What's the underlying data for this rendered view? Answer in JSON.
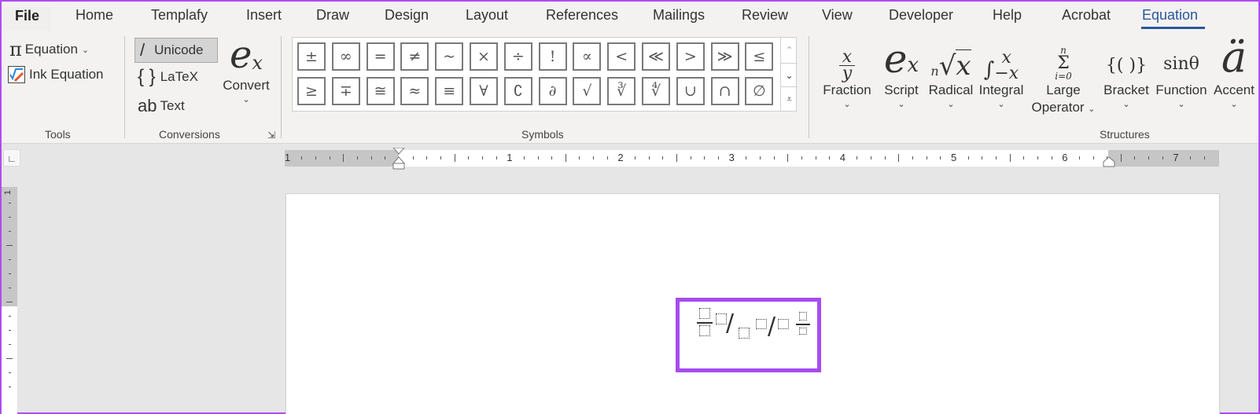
{
  "tabs": [
    {
      "label": "File"
    },
    {
      "label": "Home"
    },
    {
      "label": "Templafy"
    },
    {
      "label": "Insert"
    },
    {
      "label": "Draw"
    },
    {
      "label": "Design"
    },
    {
      "label": "Layout"
    },
    {
      "label": "References"
    },
    {
      "label": "Mailings"
    },
    {
      "label": "Review"
    },
    {
      "label": "View"
    },
    {
      "label": "Developer"
    },
    {
      "label": "Help"
    },
    {
      "label": "Acrobat"
    },
    {
      "label": "Equation",
      "active": true
    }
  ],
  "accent_color": "#2b579a",
  "highlight_color": "#a64cf0",
  "tools": {
    "equation_label": "Equation",
    "ink_equation_label": "Ink Equation",
    "group_label": "Tools"
  },
  "conversions": {
    "unicode_label": "Unicode",
    "latex_label": "LaTeX",
    "text_label": "Text",
    "convert_label": "Convert",
    "group_label": "Conversions",
    "selected": "Unicode"
  },
  "symbols": {
    "row1": [
      "±",
      "∞",
      "=",
      "≠",
      "~",
      "×",
      "÷",
      "!",
      "∝",
      "<",
      "≪",
      ">",
      "≫",
      "≤"
    ],
    "row2": [
      "≥",
      "∓",
      "≅",
      "≈",
      "≡",
      "∀",
      "∁",
      "∂",
      "√",
      "∛",
      "∜",
      "∪",
      "∩",
      "∅"
    ],
    "group_label": "Symbols"
  },
  "structures": {
    "items": [
      {
        "label": "Fraction"
      },
      {
        "label": "Script"
      },
      {
        "label": "Radical"
      },
      {
        "label": "Integral"
      },
      {
        "label": "Large",
        "label2": "Operator"
      },
      {
        "label": "Bracket"
      },
      {
        "label": "Function"
      },
      {
        "label": "Accent"
      }
    ],
    "group_label": "Structures"
  },
  "ruler": {
    "numbers": [
      "1",
      "1",
      "2",
      "3",
      "4",
      "5",
      "6",
      "7"
    ],
    "vertical_numbers": [
      "1"
    ]
  }
}
